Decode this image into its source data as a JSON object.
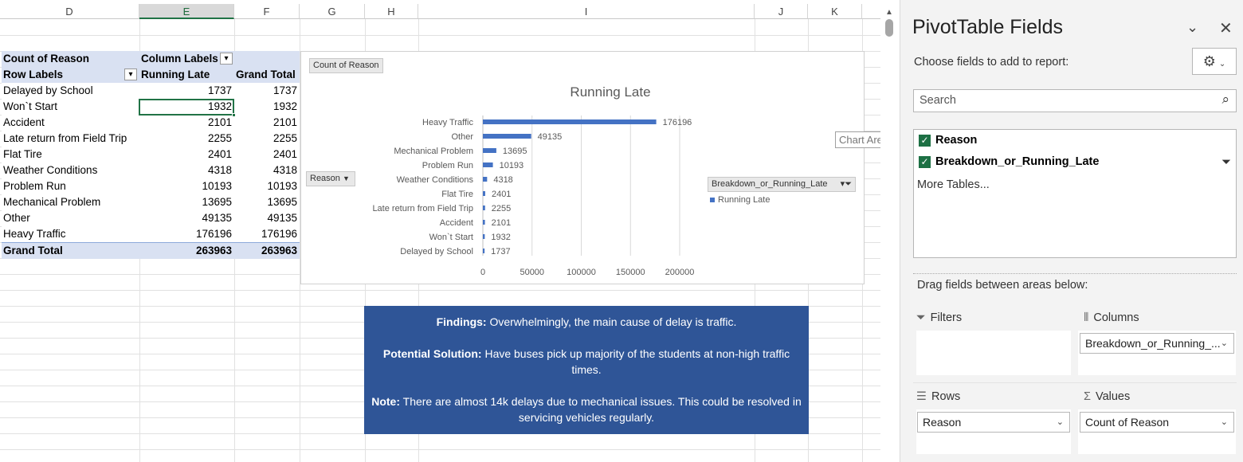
{
  "columns": [
    "D",
    "E",
    "F",
    "G",
    "H",
    "I",
    "J",
    "K"
  ],
  "pivot": {
    "count_label": "Count of Reason",
    "column_labels": "Column Labels",
    "row_labels": "Row Labels",
    "running_late": "Running Late",
    "grand_total": "Grand Total",
    "rows": [
      {
        "label": "Delayed by School",
        "running_late": "1737",
        "total": "1737"
      },
      {
        "label": "Won`t Start",
        "running_late": "1932",
        "total": "1932"
      },
      {
        "label": "Accident",
        "running_late": "2101",
        "total": "2101"
      },
      {
        "label": "Late return from Field Trip",
        "running_late": "2255",
        "total": "2255"
      },
      {
        "label": "Flat Tire",
        "running_late": "2401",
        "total": "2401"
      },
      {
        "label": "Weather Conditions",
        "running_late": "4318",
        "total": "4318"
      },
      {
        "label": "Problem Run",
        "running_late": "10193",
        "total": "10193"
      },
      {
        "label": "Mechanical Problem",
        "running_late": "13695",
        "total": "13695"
      },
      {
        "label": "Other",
        "running_late": "49135",
        "total": "49135"
      },
      {
        "label": "Heavy Traffic",
        "running_late": "176196",
        "total": "176196"
      }
    ],
    "grand_total_label": "Grand Total",
    "grand_total_running_late": "263963",
    "grand_total_total": "263963"
  },
  "chart": {
    "count_button": "Count of Reason",
    "reason_button": "Reason",
    "legend_field_button": "Breakdown_or_Running_Late",
    "tooltip": "Chart Area"
  },
  "chart_data": {
    "type": "bar",
    "orientation": "horizontal",
    "title": "Running Late",
    "categories": [
      "Heavy Traffic",
      "Other",
      "Mechanical Problem",
      "Problem Run",
      "Weather Conditions",
      "Flat Tire",
      "Late return from Field Trip",
      "Accident",
      "Won`t Start",
      "Delayed by School"
    ],
    "series": [
      {
        "name": "Running Late",
        "values": [
          176196,
          49135,
          13695,
          10193,
          4318,
          2401,
          2255,
          2101,
          1932,
          1737
        ]
      }
    ],
    "xlim": [
      0,
      200000
    ],
    "xticks": [
      "0",
      "50000",
      "100000",
      "150000",
      "200000"
    ],
    "grid": true,
    "legend": "right",
    "color": "#4472c4"
  },
  "findings": {
    "p1_bold": "Findings:",
    "p1_text": " Overwhelmingly, the main cause of delay is traffic.",
    "p2_bold": "Potential Solution:",
    "p2_text": " Have buses pick up majority of the students at non-high traffic times.",
    "p3_bold": "Note:",
    "p3_text": " There are almost 14k delays due to mechanical issues. This could be resolved in servicing vehicles regularly."
  },
  "pane": {
    "title": "PivotTable Fields",
    "choose_label": "Choose fields to add to report:",
    "search_placeholder": "Search",
    "fields": [
      {
        "label": "Reason",
        "checked": true
      },
      {
        "label": "Breakdown_or_Running_Late",
        "checked": true
      }
    ],
    "more_tables": "More Tables...",
    "drag_label": "Drag fields between areas below:",
    "filters_label": "Filters",
    "columns_label": "Columns",
    "rows_label": "Rows",
    "values_label": "Values",
    "columns_value": "Breakdown_or_Running_...",
    "rows_value": "Reason",
    "values_value": "Count of Reason"
  }
}
